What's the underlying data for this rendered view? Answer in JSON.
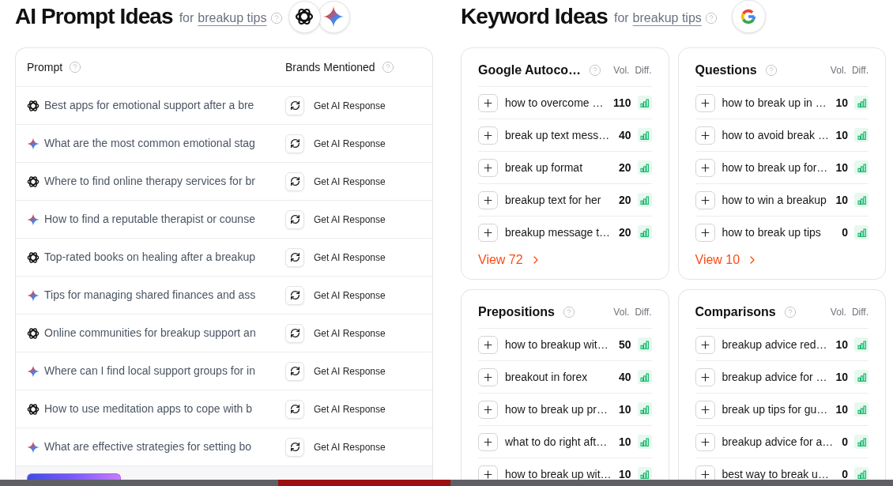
{
  "prompt_ideas": {
    "title": "AI Prompt Ideas",
    "for_label": "for",
    "topic": "breakup tips",
    "table": {
      "columns": [
        "Prompt",
        "Brands Mentioned"
      ],
      "rows": [
        {
          "kind": "chatgpt",
          "prompt": "Best apps for emotional support after a bre",
          "action": "Get AI Response"
        },
        {
          "kind": "gemini",
          "prompt": "What are the most common emotional stag",
          "action": "Get AI Response"
        },
        {
          "kind": "chatgpt",
          "prompt": "Where to find online therapy services for br",
          "action": "Get AI Response"
        },
        {
          "kind": "gemini",
          "prompt": "How to find a reputable therapist or counse",
          "action": "Get AI Response"
        },
        {
          "kind": "chatgpt",
          "prompt": "Top-rated books on healing after a breakup",
          "action": "Get AI Response"
        },
        {
          "kind": "gemini",
          "prompt": "Tips for managing shared finances and ass",
          "action": "Get AI Response"
        },
        {
          "kind": "chatgpt",
          "prompt": "Online communities for breakup support an",
          "action": "Get AI Response"
        },
        {
          "kind": "gemini",
          "prompt": "Where can I find local support groups for in",
          "action": "Get AI Response"
        },
        {
          "kind": "chatgpt",
          "prompt": "How to use meditation apps to cope with b",
          "action": "Get AI Response"
        },
        {
          "kind": "gemini",
          "prompt": "What are effective strategies for setting bo",
          "action": "Get AI Response"
        }
      ]
    }
  },
  "keyword_ideas": {
    "title": "Keyword Ideas",
    "for_label": "for",
    "topic": "breakup tips",
    "cards": [
      {
        "title": "Google Autoco…",
        "vol_label": "Vol.",
        "diff_label": "Diff.",
        "keywords": [
          {
            "keyword": "how to overcome …",
            "volume": "110"
          },
          {
            "keyword": "break up text mess…",
            "volume": "40"
          },
          {
            "keyword": "break up format",
            "volume": "20"
          },
          {
            "keyword": "breakup text for her",
            "volume": "20"
          },
          {
            "keyword": "breakup message t…",
            "volume": "20"
          }
        ],
        "view_link": "View 72"
      },
      {
        "title": "Questions",
        "vol_label": "Vol.",
        "diff_label": "Diff.",
        "keywords": [
          {
            "keyword": "how to break up in …",
            "volume": "10"
          },
          {
            "keyword": "how to avoid break …",
            "volume": "10"
          },
          {
            "keyword": "how to break up for…",
            "volume": "10"
          },
          {
            "keyword": "how to win a breakup",
            "volume": "10"
          },
          {
            "keyword": "how to break up tips",
            "volume": "0"
          }
        ],
        "view_link": "View 10"
      },
      {
        "title": "Prepositions",
        "vol_label": "Vol.",
        "diff_label": "Diff.",
        "keywords": [
          {
            "keyword": "how to breakup wit…",
            "volume": "50"
          },
          {
            "keyword": "breakout in forex",
            "volume": "40"
          },
          {
            "keyword": "how to break up pr…",
            "volume": "10"
          },
          {
            "keyword": "what to do right aft…",
            "volume": "10"
          },
          {
            "keyword": "how to break up wit…",
            "volume": "10"
          }
        ]
      },
      {
        "title": "Comparisons",
        "vol_label": "Vol.",
        "diff_label": "Diff.",
        "keywords": [
          {
            "keyword": "breakup advice red…",
            "volume": "10"
          },
          {
            "keyword": "breakup advice for …",
            "volume": "10"
          },
          {
            "keyword": "break up tips for gu…",
            "volume": "10"
          },
          {
            "keyword": "breakup advice for a…",
            "volume": "0"
          },
          {
            "keyword": "best way to break u…",
            "volume": "0"
          }
        ]
      }
    ]
  }
}
